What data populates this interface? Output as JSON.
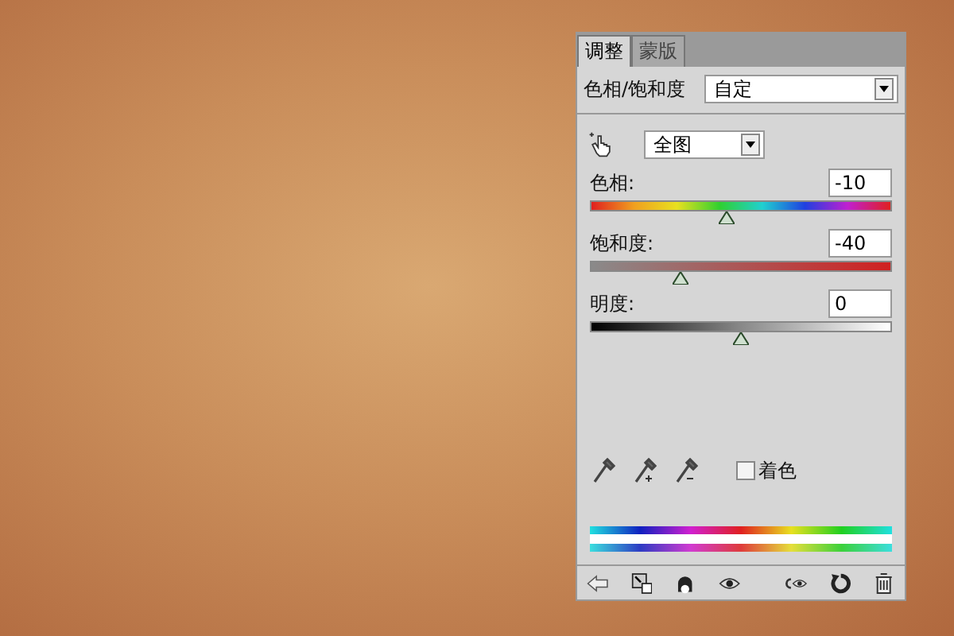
{
  "tabs": [
    {
      "label": "调整",
      "selected": true
    },
    {
      "label": "蒙版",
      "selected": false
    }
  ],
  "preset": {
    "label": "色相/饱和度",
    "value": "自定"
  },
  "channel": {
    "value": "全图"
  },
  "sliders": [
    {
      "kind": "hue",
      "label": "色相:",
      "value": "-10",
      "level": 0.45
    },
    {
      "kind": "saturation",
      "label": "饱和度:",
      "value": "-40",
      "level": 0.3
    },
    {
      "kind": "lightness",
      "label": "明度:",
      "value": "0",
      "level": 0.5
    }
  ],
  "colorize": {
    "label": "着色",
    "checked": false
  }
}
